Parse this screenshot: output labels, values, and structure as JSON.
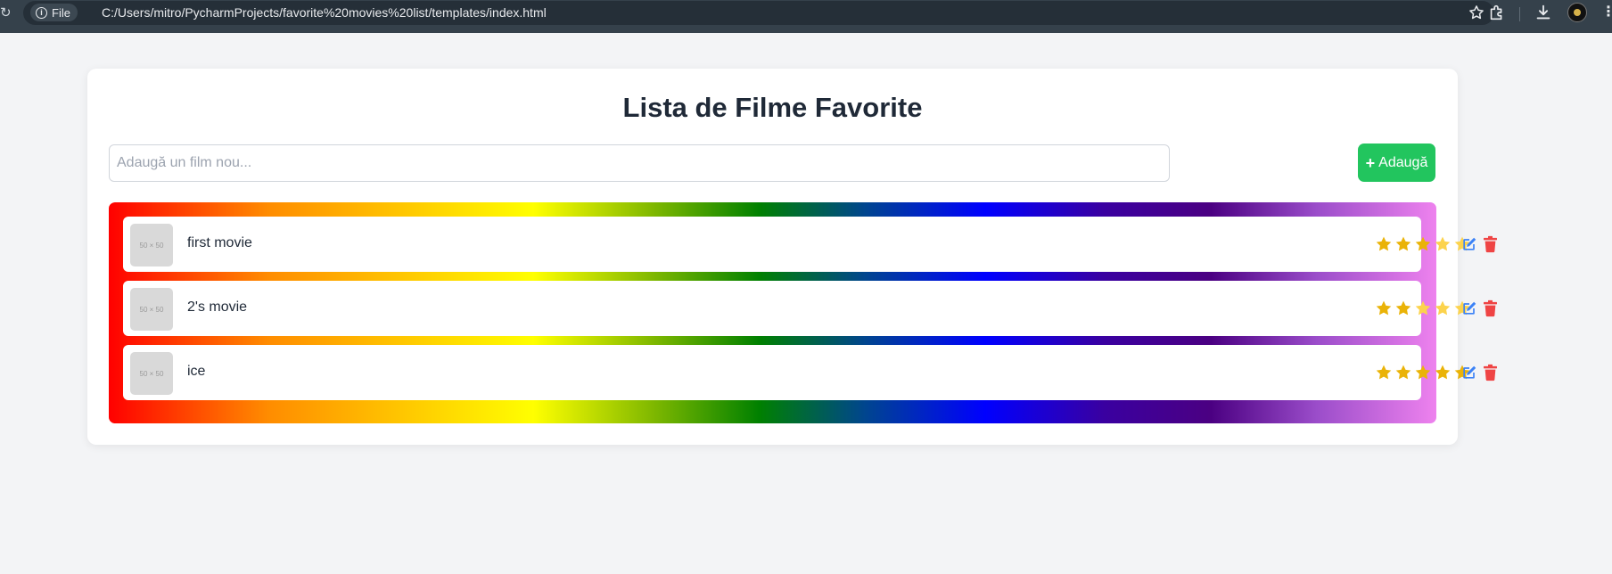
{
  "browser": {
    "chip_label": "File",
    "url": "C:/Users/mitro/PycharmProjects/favorite%20movies%20list/templates/index.html"
  },
  "page": {
    "title": "Lista de Filme Favorite",
    "input_placeholder": "Adaugă un film nou...",
    "add_button_label": "Adaugă"
  },
  "colors": {
    "accent_green": "#22c55e",
    "star_filled": "#eab308",
    "star_empty": "#fcd34d",
    "edit_blue": "#3b82f6",
    "delete_red": "#ef4444"
  },
  "movies": [
    {
      "name": "first movie",
      "thumb_text": "50 × 50",
      "rating": 3,
      "max_rating": 5
    },
    {
      "name": "2's movie",
      "thumb_text": "50 × 50",
      "rating": 2,
      "max_rating": 5
    },
    {
      "name": "ice",
      "thumb_text": "50 × 50",
      "rating": 5,
      "max_rating": 5
    }
  ]
}
